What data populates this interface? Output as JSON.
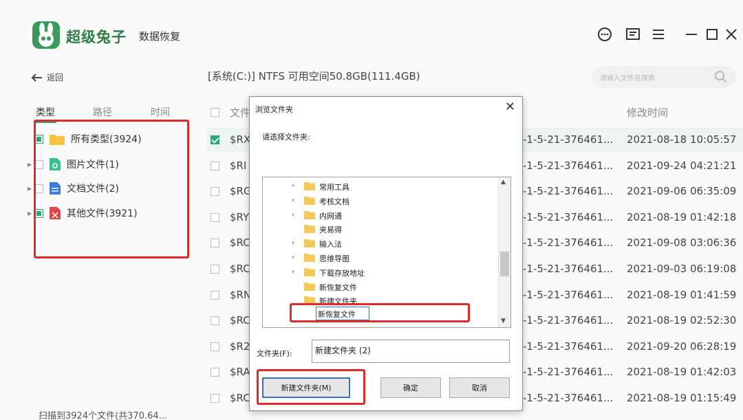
{
  "app": {
    "brand": "超级兔子",
    "subtitle": "数据恢复"
  },
  "nav": {
    "back_label": "返回"
  },
  "filter_tabs": [
    "类型",
    "路径",
    "时间"
  ],
  "tree": [
    {
      "label": "所有类型(3924)",
      "state": "partial",
      "icon": "folder-icon"
    },
    {
      "label": "图片文件(1)",
      "state": "unchecked",
      "icon": "image-file-icon"
    },
    {
      "label": "文档文件(2)",
      "state": "unchecked",
      "icon": "document-file-icon"
    },
    {
      "label": "其他文件(3921)",
      "state": "partial",
      "icon": "other-file-icon"
    }
  ],
  "status_text": "扫描到3924个文件(共370.64...",
  "path_bar": "[系统(C:)] NTFS 可用空间50.8GB(111.4GB)",
  "search": {
    "placeholder": "请输入文件名搜索"
  },
  "columns": {
    "name": "文件",
    "modified": "修改时间"
  },
  "rows": [
    {
      "name": "$RX",
      "path": "-1-5-21-376461...",
      "time": "2021-08-18 10:05:57",
      "checked": true
    },
    {
      "name": "$RI",
      "path": "-1-5-21-376461...",
      "time": "2021-09-24 04:21:21",
      "checked": false
    },
    {
      "name": "$RG",
      "path": "-1-5-21-376461...",
      "time": "2021-09-06 06:35:09",
      "checked": false
    },
    {
      "name": "$RY",
      "path": "-1-5-21-376461...",
      "time": "2021-08-19 01:42:18",
      "checked": false
    },
    {
      "name": "$RC",
      "path": "-1-5-21-376461...",
      "time": "2021-09-08 03:06:36",
      "checked": false
    },
    {
      "name": "$RC",
      "path": "-1-5-21-376461...",
      "time": "2021-09-03 06:19:08",
      "checked": false
    },
    {
      "name": "$RN",
      "path": "-1-5-21-376461...",
      "time": "2021-08-19 01:41:59",
      "checked": false
    },
    {
      "name": "$RC",
      "path": "-1-5-21-376461...",
      "time": "2021-08-19 02:52:30",
      "checked": false
    },
    {
      "name": "$R2",
      "path": "-1-5-21-376461...",
      "time": "2021-09-20 06:28:19",
      "checked": false
    },
    {
      "name": "$RA",
      "path": "-1-5-21-376461...",
      "time": "2021-08-19 01:42:03",
      "checked": false
    },
    {
      "name": "$RC",
      "path": "-1-5-21-376461...",
      "time": "2021-08-19 01:15:49",
      "checked": false
    }
  ],
  "dialog": {
    "title": "浏览文件夹",
    "prompt": "请选择文件夹:",
    "folders": [
      {
        "label": "常用工具",
        "expandable": true
      },
      {
        "label": "考核文档",
        "expandable": true
      },
      {
        "label": "内网通",
        "expandable": true
      },
      {
        "label": "夹易得",
        "expandable": false
      },
      {
        "label": "输入法",
        "expandable": true
      },
      {
        "label": "思维导图",
        "expandable": true
      },
      {
        "label": "下载存放地址",
        "expandable": true
      },
      {
        "label": "新恢复文件",
        "expandable": false
      },
      {
        "label": "新建文件夹",
        "expandable": false
      }
    ],
    "rename_value": "新恢复文件",
    "folder_label": "文件夹(F):",
    "folder_value": "新建文件夹 (2)",
    "new_folder_button": "新建文件夹(M)",
    "ok_button": "确定",
    "cancel_button": "取消"
  },
  "colors": {
    "accent": "#2aa876",
    "highlight": "#e02a2a",
    "dialog_focus": "#3a6fc6"
  }
}
